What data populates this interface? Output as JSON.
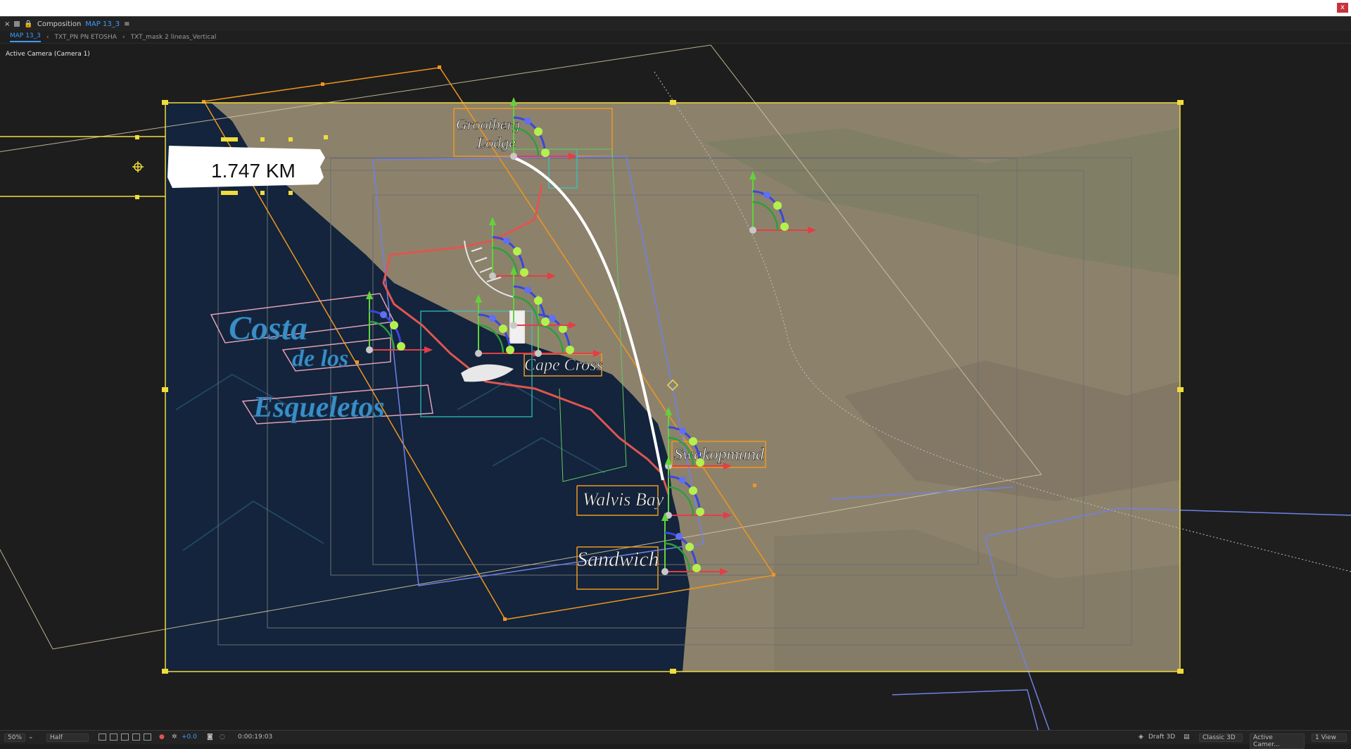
{
  "window": {
    "close_label": "x"
  },
  "panel": {
    "prefix": "Composition",
    "comp_name": "MAP 13_3",
    "menu_icon": "hamburger-icon"
  },
  "tabs": [
    {
      "label": "MAP 13_3"
    },
    {
      "label": "TXT_PN PN ETOSHA"
    },
    {
      "label": "TXT_mask 2 lineas_Vertical"
    }
  ],
  "viewer": {
    "camera_label": "Active Camera (Camera 1)"
  },
  "map": {
    "distance_label": "1.747 KM",
    "coast_title": [
      "Costa",
      "de los",
      "Esqueletos"
    ],
    "places": {
      "grootberg": [
        "Grootberg",
        "Lodge"
      ],
      "cape_cross": "Cape Cross",
      "swakopmund": "Swakopmund",
      "walvis_bay": "Walvis Bay",
      "sandwich": "Sandwich"
    }
  },
  "bottom": {
    "zoom": "50%",
    "resolution": "Half",
    "exposure": "+0.0",
    "timecode": "0:00:19:03",
    "renderer": "Draft 3D",
    "renderer_mode": "Classic 3D",
    "view_camera": "Active Camer...",
    "view_layout": "1 View"
  },
  "colors": {
    "accent_blue": "#3b9cff",
    "ocean": "#13243c",
    "land": "#8c826c",
    "path_red": "#e05550",
    "handle_orange": "#f0961e",
    "handle_yellow": "#f0dc3c"
  }
}
